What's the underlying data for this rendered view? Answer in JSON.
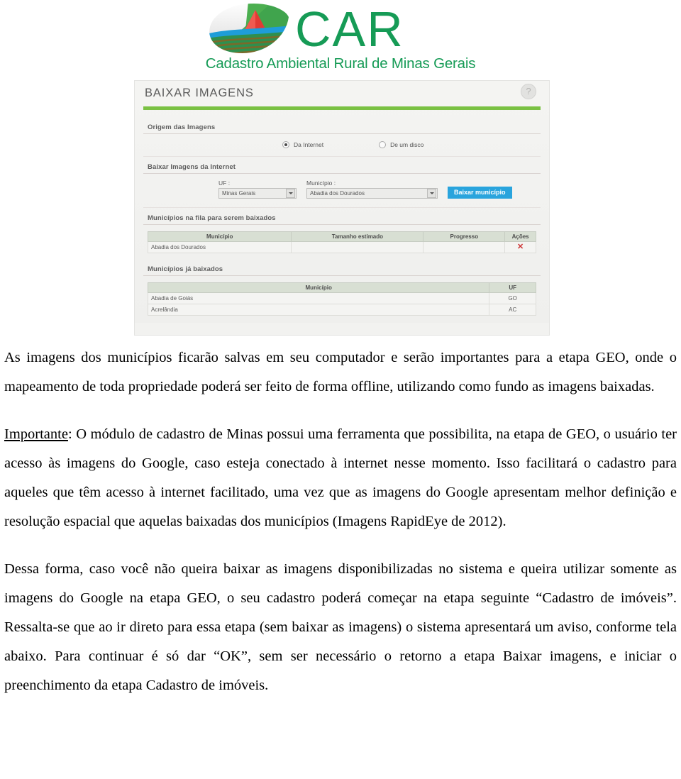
{
  "logo": {
    "brand": "CAR",
    "subtitle": "Cadastro Ambiental Rural de Minas Gerais",
    "brand_color": "#169b56"
  },
  "screenshot": {
    "title": "BAIXAR IMAGENS",
    "help_icon": "?",
    "accent_bar_color": "#7ac143",
    "sections": {
      "origem": {
        "title": "Origem das Imagens",
        "options": [
          {
            "label": "Da Internet",
            "selected": true
          },
          {
            "label": "De um disco",
            "selected": false
          }
        ]
      },
      "baixar_internet": {
        "title": "Baixar Imagens da Internet",
        "uf_label": "UF :",
        "uf_value": "Minas Gerais",
        "municipio_label": "Município :",
        "municipio_value": "Abadia dos Dourados",
        "button_label": "Baixar município",
        "button_color": "#29a4dd"
      },
      "fila": {
        "title": "Municípios na fila para serem baixados",
        "columns": [
          "Município",
          "Tamanho estimado",
          "Progresso",
          "Ações"
        ],
        "rows": [
          {
            "municipio": "Abadia dos Dourados",
            "tamanho": "",
            "progresso": "",
            "acoes": "✕"
          }
        ],
        "action_icon_color": "#cc3333"
      },
      "baixados": {
        "title": "Municípios já baixados",
        "columns": [
          "Município",
          "UF"
        ],
        "rows": [
          {
            "municipio": "Abadia de Goiás",
            "uf": "GO"
          },
          {
            "municipio": "Acrelândia",
            "uf": "AC"
          }
        ]
      }
    }
  },
  "document": {
    "paragraph_1": "As imagens dos municípios ficarão salvas em seu computador e serão importantes para a etapa GEO, onde o mapeamento de toda propriedade poderá ser feito de forma offline, utilizando como fundo as imagens baixadas.",
    "paragraph_2_lead": "Importante",
    "paragraph_2": ": O módulo de cadastro de Minas possui uma ferramenta que possibilita, na etapa de GEO, o usuário ter acesso às imagens do Google, caso esteja conectado à internet nesse momento. Isso facilitará o cadastro para aqueles que têm acesso à internet facilitado, uma vez que as imagens do Google apresentam melhor definição e resolução espacial que aquelas baixadas dos municípios (Imagens RapidEye de 2012).",
    "paragraph_3": "Dessa forma, caso você não queira baixar as imagens disponibilizadas no sistema e queira utilizar somente as imagens do Google na etapa GEO, o seu cadastro poderá começar na etapa seguinte “Cadastro de imóveis”. Ressalta-se que ao ir direto para essa etapa (sem baixar as imagens) o sistema apresentará um aviso, conforme tela abaixo. Para continuar é só dar “OK”, sem ser necessário o retorno a etapa Baixar imagens, e iniciar o preenchimento da etapa Cadastro de imóveis."
  }
}
